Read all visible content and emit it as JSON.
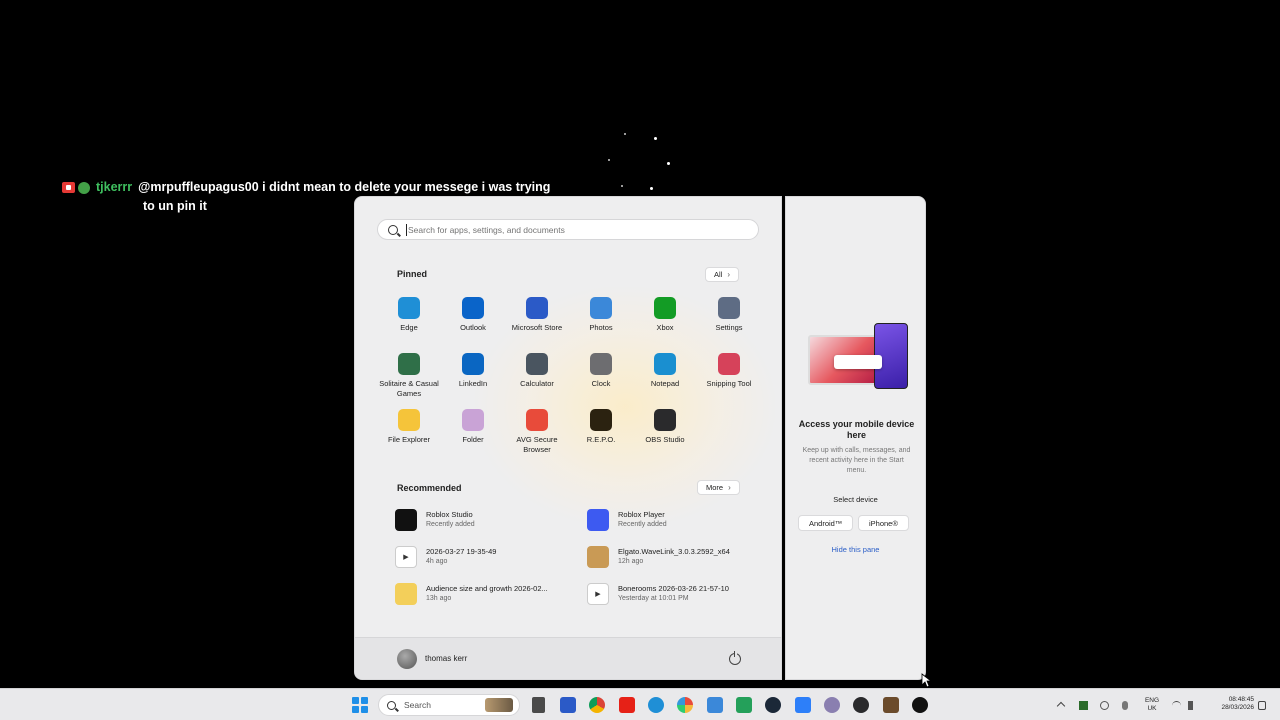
{
  "chat": {
    "username": "tjkerrr",
    "message_line1": "@mrpuffleupagus00 i didnt mean to delete your messege i was trying",
    "message_line2": "to un pin it"
  },
  "start_menu": {
    "search_placeholder": "Search for apps, settings, and documents",
    "pinned_title": "Pinned",
    "all_label": "All",
    "pinned_apps": [
      {
        "label": "Edge",
        "icon": "edge-icon",
        "color": "#1f8fd6"
      },
      {
        "label": "Outlook",
        "icon": "outlook-icon",
        "color": "#0a64c9"
      },
      {
        "label": "Microsoft Store",
        "icon": "store-icon",
        "color": "#2b5ac7"
      },
      {
        "label": "Photos",
        "icon": "photos-icon",
        "color": "#3b88d9"
      },
      {
        "label": "Xbox",
        "icon": "xbox-icon",
        "color": "#139c25"
      },
      {
        "label": "Settings",
        "icon": "gear-icon",
        "color": "#5e6c84"
      },
      {
        "label": "Solitaire & Casual Games",
        "icon": "cards-icon",
        "color": "#2f6f48"
      },
      {
        "label": "LinkedIn",
        "icon": "linkedin-icon",
        "color": "#0a66c2"
      },
      {
        "label": "Calculator",
        "icon": "calculator-icon",
        "color": "#4a5560"
      },
      {
        "label": "Clock",
        "icon": "clock-icon",
        "color": "#6d6d70"
      },
      {
        "label": "Notepad",
        "icon": "notepad-icon",
        "color": "#1a8fd0"
      },
      {
        "label": "Snipping Tool",
        "icon": "scissors-icon",
        "color": "#d6425a"
      },
      {
        "label": "File Explorer",
        "icon": "folder-icon",
        "color": "#f5c43a"
      },
      {
        "label": "Folder",
        "icon": "folder-image-icon",
        "color": "#c9a3d6"
      },
      {
        "label": "AVG Secure Browser",
        "icon": "avg-icon",
        "color": "#e84b3a"
      },
      {
        "label": "R.E.P.O.",
        "icon": "repo-icon",
        "color": "#2b2210"
      },
      {
        "label": "OBS Studio",
        "icon": "obs-icon",
        "color": "#2a2a2c"
      }
    ],
    "recommended_title": "Recommended",
    "more_label": "More",
    "recommended": [
      {
        "title": "Roblox Studio",
        "sub": "Recently added",
        "icon": "roblox-studio-icon",
        "color": "#111111"
      },
      {
        "title": "Roblox Player",
        "sub": "Recently added",
        "icon": "roblox-player-icon",
        "color": "#3d5af1"
      },
      {
        "title": "2026-03-27 19-35-49",
        "sub": "4h ago",
        "icon": "video-file-icon",
        "color": "#ffffff"
      },
      {
        "title": "Elgato.WaveLink_3.0.3.2592_x64",
        "sub": "12h ago",
        "icon": "package-icon",
        "color": "#c99a55"
      },
      {
        "title": "Audience size and growth 2026-02...",
        "sub": "13h ago",
        "icon": "folder-zip-icon",
        "color": "#f3cf5a"
      },
      {
        "title": "Bonerooms 2026-03-26 21-57-10",
        "sub": "Yesterday at 10:01 PM",
        "icon": "video-file-icon",
        "color": "#ffffff"
      }
    ],
    "user_name": "thomas kerr"
  },
  "phone_pane": {
    "heading": "Access your mobile device here",
    "description": "Keep up with calls, messages, and recent activity here in the Start menu.",
    "select_label": "Select device",
    "android_label": "Android™",
    "iphone_label": "iPhone®",
    "hide_label": "Hide this pane"
  },
  "taskbar": {
    "search_label": "Search",
    "language_line1": "ENG",
    "language_line2": "UK",
    "time": "08:48:45",
    "date": "28/03/2026"
  }
}
